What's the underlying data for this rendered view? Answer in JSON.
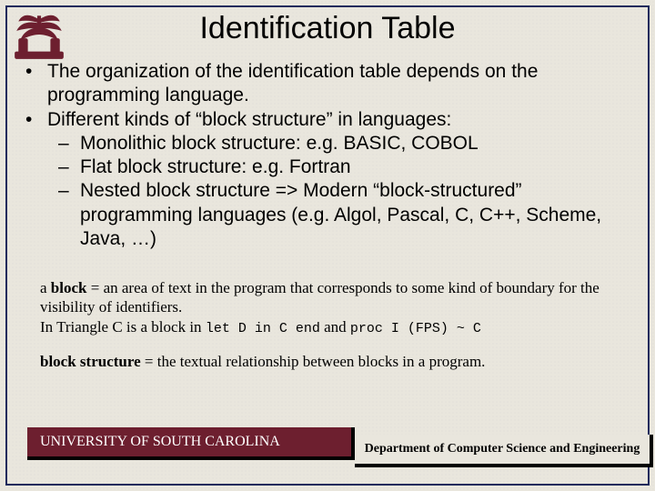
{
  "title": "Identification Table",
  "bullets": [
    {
      "text": "The organization of the identification table depends on the programming language."
    },
    {
      "text": "Different kinds of “block structure” in languages:",
      "subs": [
        "Monolithic block structure: e.g. BASIC, COBOL",
        "Flat block structure: e.g. Fortran",
        "Nested block structure => Modern “block-structured” programming languages (e.g. Algol, Pascal, C, C++, Scheme, Java, …)"
      ]
    }
  ],
  "notes": {
    "block_def_prefix": "a ",
    "block_def_bold": "block",
    "block_def_rest": " = an area of text in the program that corresponds to some kind of boundary for the visibility of identifiers.",
    "triangle_line_a": "In Triangle C is a block in ",
    "triangle_code_a": "let D in C end",
    "triangle_line_b": " and ",
    "triangle_code_b": "proc I (FPS) ~ C",
    "struct_bold": "block structure",
    "struct_rest": " = the textual relationship between blocks in a program."
  },
  "footer": {
    "university": "UNIVERSITY OF SOUTH CAROLINA",
    "department": "Department of Computer Science and Engineering"
  },
  "marks": {
    "bullet": "•",
    "dash": "–"
  }
}
